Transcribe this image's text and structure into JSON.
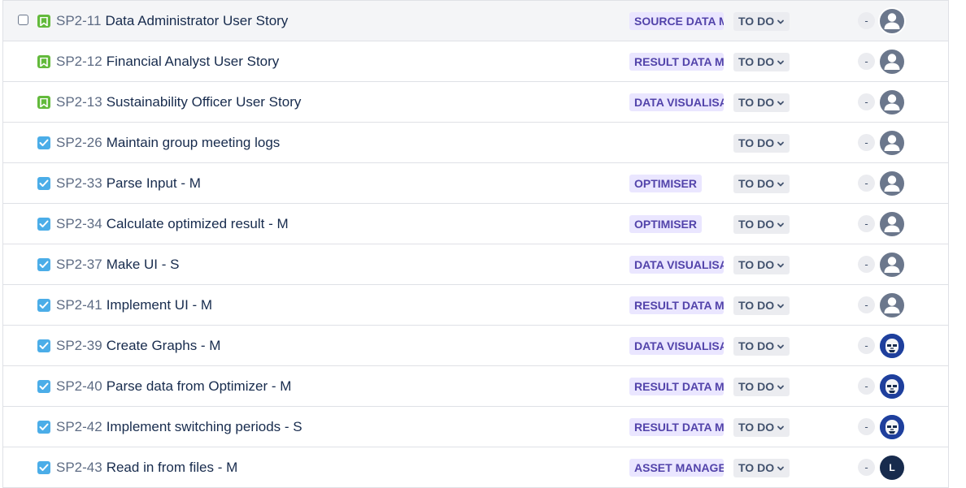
{
  "colors": {
    "story": "#63ba3c",
    "task": "#4bade8",
    "epic_bg": "#eae6ff",
    "epic_text": "#5243aa",
    "status_bg": "#ebecf0"
  },
  "rows": [
    {
      "key": "SP2-11",
      "summary": "Data Administrator User Story",
      "type": "story",
      "epic": "SOURCE DATA M",
      "status": "TO DO",
      "estimate": "-",
      "assignee": "default",
      "assignee_initial": ""
    },
    {
      "key": "SP2-12",
      "summary": "Financial Analyst User Story",
      "type": "story",
      "epic": "RESULT DATA MA",
      "status": "TO DO",
      "estimate": "-",
      "assignee": "default",
      "assignee_initial": ""
    },
    {
      "key": "SP2-13",
      "summary": "Sustainability Officer User Story",
      "type": "story",
      "epic": "DATA VISUALISA",
      "status": "TO DO",
      "estimate": "-",
      "assignee": "default",
      "assignee_initial": ""
    },
    {
      "key": "SP2-26",
      "summary": "Maintain group meeting logs",
      "type": "task",
      "epic": "",
      "status": "TO DO",
      "estimate": "-",
      "assignee": "default",
      "assignee_initial": ""
    },
    {
      "key": "SP2-33",
      "summary": "Parse Input - M",
      "type": "task",
      "epic": "OPTIMISER",
      "status": "TO DO",
      "estimate": "-",
      "assignee": "default",
      "assignee_initial": ""
    },
    {
      "key": "SP2-34",
      "summary": "Calculate optimized result - M",
      "type": "task",
      "epic": "OPTIMISER",
      "status": "TO DO",
      "estimate": "-",
      "assignee": "default",
      "assignee_initial": ""
    },
    {
      "key": "SP2-37",
      "summary": "Make UI - S",
      "type": "task",
      "epic": "DATA VISUALISA",
      "status": "TO DO",
      "estimate": "-",
      "assignee": "default",
      "assignee_initial": ""
    },
    {
      "key": "SP2-41",
      "summary": "Implement UI - M",
      "type": "task",
      "epic": "RESULT DATA MA",
      "status": "TO DO",
      "estimate": "-",
      "assignee": "default",
      "assignee_initial": ""
    },
    {
      "key": "SP2-39",
      "summary": "Create Graphs - M",
      "type": "task",
      "epic": "DATA VISUALISA",
      "status": "TO DO",
      "estimate": "-",
      "assignee": "image",
      "assignee_initial": ""
    },
    {
      "key": "SP2-40",
      "summary": "Parse data from Optimizer - M",
      "type": "task",
      "epic": "RESULT DATA MA",
      "status": "TO DO",
      "estimate": "-",
      "assignee": "image",
      "assignee_initial": ""
    },
    {
      "key": "SP2-42",
      "summary": "Implement switching periods - S",
      "type": "task",
      "epic": "RESULT DATA MA",
      "status": "TO DO",
      "estimate": "-",
      "assignee": "image",
      "assignee_initial": ""
    },
    {
      "key": "SP2-43",
      "summary": "Read in from files - M",
      "type": "task",
      "epic": "ASSET MANAGEI",
      "status": "TO DO",
      "estimate": "-",
      "assignee": "letter",
      "assignee_initial": "L"
    }
  ]
}
